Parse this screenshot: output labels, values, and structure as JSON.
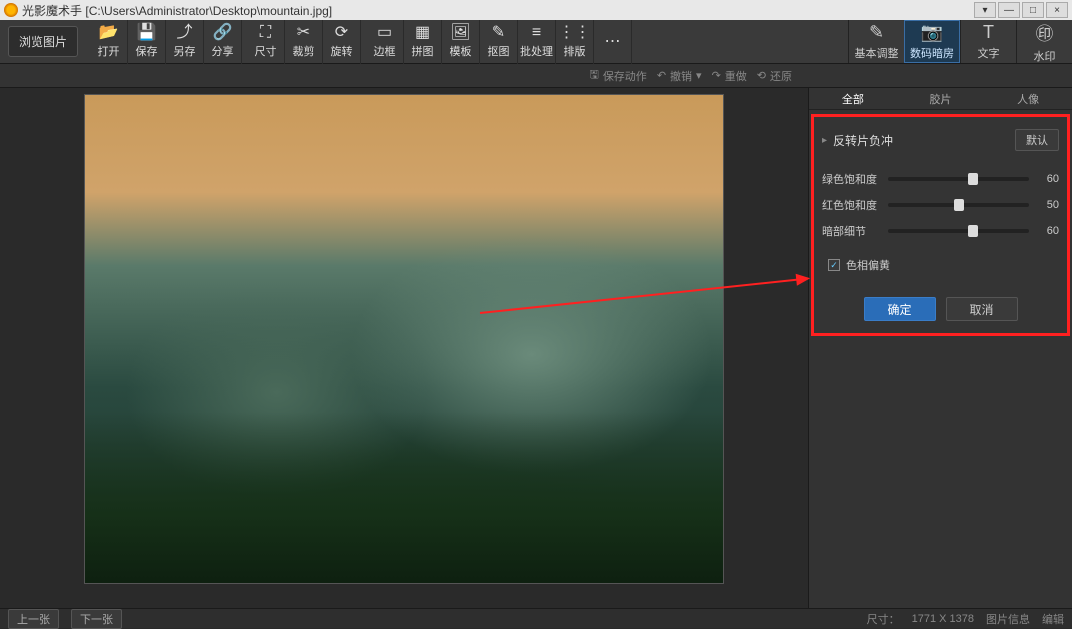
{
  "titlebar": {
    "app_name": "光影魔术手",
    "file_path": "[C:\\Users\\Administrator\\Desktop\\mountain.jpg]"
  },
  "window_controls": {
    "min": "—",
    "max": "□",
    "close": "×",
    "menu": "▾"
  },
  "browse_label": "浏览图片",
  "toolbar_items": [
    {
      "icon": "📂",
      "label": "打开"
    },
    {
      "icon": "💾",
      "label": "保存"
    },
    {
      "icon": "⤴",
      "label": "另存"
    },
    {
      "icon": "🔗",
      "label": "分享"
    },
    {
      "icon": "⛶",
      "label": "尺寸"
    },
    {
      "icon": "✂",
      "label": "裁剪"
    },
    {
      "icon": "⟳",
      "label": "旋转"
    },
    {
      "icon": "▭",
      "label": "边框"
    },
    {
      "icon": "▦",
      "label": "拼图"
    },
    {
      "icon": "🖼",
      "label": "模板"
    },
    {
      "icon": "✎",
      "label": "抠图"
    },
    {
      "icon": "≡",
      "label": "批处理"
    },
    {
      "icon": "⋮⋮",
      "label": "排版"
    },
    {
      "icon": "⋯",
      "label": ""
    }
  ],
  "right_tabs": [
    {
      "icon": "✎",
      "label": "基本调整"
    },
    {
      "icon": "📷",
      "label": "数码暗房"
    },
    {
      "icon": "T",
      "label": "文字"
    },
    {
      "icon": "㊞",
      "label": "水印"
    }
  ],
  "right_tabs_active_index": 1,
  "subbar": {
    "save_action": "保存动作",
    "undo": "撤销",
    "redo": "重做",
    "revert": "还原"
  },
  "panel_tabs": [
    "全部",
    "胶片",
    "人像"
  ],
  "panel_tabs_active_index": 0,
  "effect": {
    "name": "反转片负冲",
    "default_btn": "默认",
    "sliders": [
      {
        "label": "绿色饱和度",
        "value": 60,
        "max": 100
      },
      {
        "label": "红色饱和度",
        "value": 50,
        "max": 100
      },
      {
        "label": "暗部细节",
        "value": 60,
        "max": 100
      }
    ],
    "checkbox": {
      "label": "色相偏黄",
      "checked": true
    },
    "ok": "确定",
    "cancel": "取消"
  },
  "status": {
    "prev": "上一张",
    "next": "下一张",
    "size_label": "尺寸：",
    "size_value": "1771 X 1378",
    "info": "图片信息",
    "edit": "编辑"
  }
}
